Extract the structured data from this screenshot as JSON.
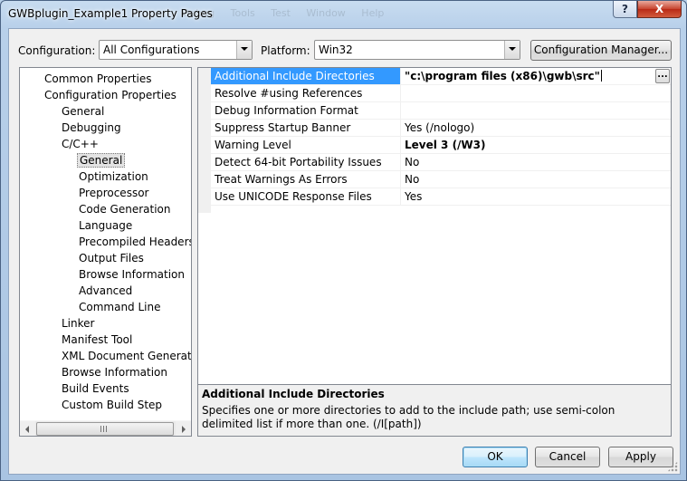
{
  "window": {
    "title": "GWBplugin_Example1 Property Pages",
    "ghost_menu": "Debug   Tools   Test   Window   Help",
    "help_label": "?",
    "close_label": "X"
  },
  "config": {
    "config_label": "Configuration:",
    "config_value": "All Configurations",
    "platform_label": "Platform:",
    "platform_value": "Win32",
    "manager_label": "Configuration Manager..."
  },
  "tree": {
    "items": [
      {
        "label": "Common Properties",
        "level": 0
      },
      {
        "label": "Configuration Properties",
        "level": 0
      },
      {
        "label": "General",
        "level": 1
      },
      {
        "label": "Debugging",
        "level": 1
      },
      {
        "label": "C/C++",
        "level": 1
      },
      {
        "label": "General",
        "level": 2,
        "selected": true
      },
      {
        "label": "Optimization",
        "level": 2
      },
      {
        "label": "Preprocessor",
        "level": 2
      },
      {
        "label": "Code Generation",
        "level": 2
      },
      {
        "label": "Language",
        "level": 2
      },
      {
        "label": "Precompiled Headers",
        "level": 2
      },
      {
        "label": "Output Files",
        "level": 2
      },
      {
        "label": "Browse Information",
        "level": 2
      },
      {
        "label": "Advanced",
        "level": 2
      },
      {
        "label": "Command Line",
        "level": 2
      },
      {
        "label": "Linker",
        "level": 1
      },
      {
        "label": "Manifest Tool",
        "level": 1
      },
      {
        "label": "XML Document Generator",
        "level": 1
      },
      {
        "label": "Browse Information",
        "level": 1
      },
      {
        "label": "Build Events",
        "level": 1
      },
      {
        "label": "Custom Build Step",
        "level": 1
      }
    ]
  },
  "properties": {
    "rows": [
      {
        "name": "Additional Include Directories",
        "value": "\"c:\\program files (x86)\\gwb\\src\"",
        "bold": true,
        "selected": true
      },
      {
        "name": "Resolve #using References",
        "value": ""
      },
      {
        "name": "Debug Information Format",
        "value": ""
      },
      {
        "name": "Suppress Startup Banner",
        "value": "Yes (/nologo)"
      },
      {
        "name": "Warning Level",
        "value": "Level 3 (/W3)",
        "bold": true
      },
      {
        "name": "Detect 64-bit Portability Issues",
        "value": "No"
      },
      {
        "name": "Treat Warnings As Errors",
        "value": "No"
      },
      {
        "name": "Use UNICODE Response Files",
        "value": "Yes"
      }
    ],
    "ellipsis_label": "..."
  },
  "description": {
    "title": "Additional Include Directories",
    "text": "Specifies one or more directories to add to the include path; use semi-colon delimited list if more than one.     (/I[path])"
  },
  "buttons": {
    "ok": "OK",
    "cancel": "Cancel",
    "apply": "Apply"
  },
  "colors": {
    "selection": "#3399ff",
    "title_bar": "#b9d1ea"
  }
}
